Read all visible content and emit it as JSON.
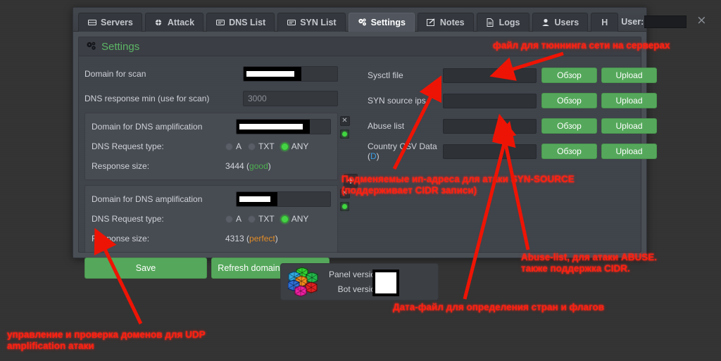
{
  "window": {
    "user_label": "User:",
    "user_value": "",
    "close_icon": "×"
  },
  "tabs": [
    {
      "label": "Servers",
      "icon": "server-icon",
      "active": false
    },
    {
      "label": "Attack",
      "icon": "crosshair-icon",
      "active": false
    },
    {
      "label": "DNS List",
      "icon": "list-icon",
      "active": false
    },
    {
      "label": "SYN List",
      "icon": "list-icon",
      "active": false
    },
    {
      "label": "Settings",
      "icon": "gears-icon",
      "active": true
    },
    {
      "label": "Notes",
      "icon": "edit-icon",
      "active": false
    },
    {
      "label": "Logs",
      "icon": "file-icon",
      "active": false
    },
    {
      "label": "Users",
      "icon": "user-icon",
      "active": false
    },
    {
      "label": "H",
      "icon": "",
      "active": false
    }
  ],
  "panel": {
    "title": "Settings",
    "title_icon": "gears-icon"
  },
  "left": {
    "domain_for_scan": {
      "label": "Domain for scan",
      "value": "",
      "redacted": true
    },
    "dns_response_min": {
      "label": "DNS response min (use for scan)",
      "value": "3000"
    },
    "amplification_boxes": [
      {
        "domain_label": "Domain for DNS amplification",
        "domain_value": "",
        "redacted": true,
        "request_type_label": "DNS Request type:",
        "request_types": [
          {
            "label": "A",
            "selected": false
          },
          {
            "label": "TXT",
            "selected": false
          },
          {
            "label": "ANY",
            "selected": true
          }
        ],
        "response_size_label": "Response size:",
        "response_size_value": "3444",
        "response_quality": "good",
        "quality_class": "good",
        "status_dot": "green",
        "close_icon": "✕"
      },
      {
        "domain_label": "Domain for DNS amplification",
        "domain_value": "",
        "redacted": true,
        "request_type_label": "DNS Request type:",
        "request_types": [
          {
            "label": "A",
            "selected": false
          },
          {
            "label": "TXT",
            "selected": false
          },
          {
            "label": "ANY",
            "selected": true
          }
        ],
        "response_size_label": "Response size:",
        "response_size_value": "4313",
        "response_quality": "perfect",
        "quality_class": "perfect",
        "status_dot": "green",
        "close_icon": "✕"
      }
    ],
    "add_button_label": "+",
    "save_label": "Save",
    "refresh_label": "Refresh domains response"
  },
  "right": {
    "browse_label": "Обзор",
    "upload_label": "Upload",
    "uploads": [
      {
        "label": "Sysctl file",
        "value": "",
        "link": ""
      },
      {
        "label": "SYN source ips",
        "value": "",
        "link": ""
      },
      {
        "label": "Abuse list",
        "value": "",
        "link": ""
      },
      {
        "label": "Country CSV Data (",
        "value": "",
        "link": "D",
        "label_suffix": ")"
      }
    ]
  },
  "version_box": {
    "panel_version_label": "Panel version:",
    "bot_version_label": "Bot version:",
    "panel_version_value": "",
    "bot_version_value": "",
    "logo_icon": "hex-cluster-logo"
  },
  "annotations": {
    "sysctl": "файл для тюннинга сети на серверах",
    "syn_source": "Подменяемые ип-адреса для атаки SYN-SOURCE\n(поддерживает CIDR записи)",
    "abuse": "Abuse-list, для атаки ABUSE.\nтакже поддержка CIDR.",
    "country": "Дата-файл для определения стран и флагов",
    "udp_amp": "управление и проверка доменов для UDP\namplification атаки"
  },
  "colors": {
    "accent_green": "#55a85b",
    "title_green": "#5cb566",
    "annotation_red": "#ff1f0f",
    "quality_good": "#4caf50",
    "quality_perfect": "#e08c27",
    "link_blue": "#3a9ee0"
  }
}
